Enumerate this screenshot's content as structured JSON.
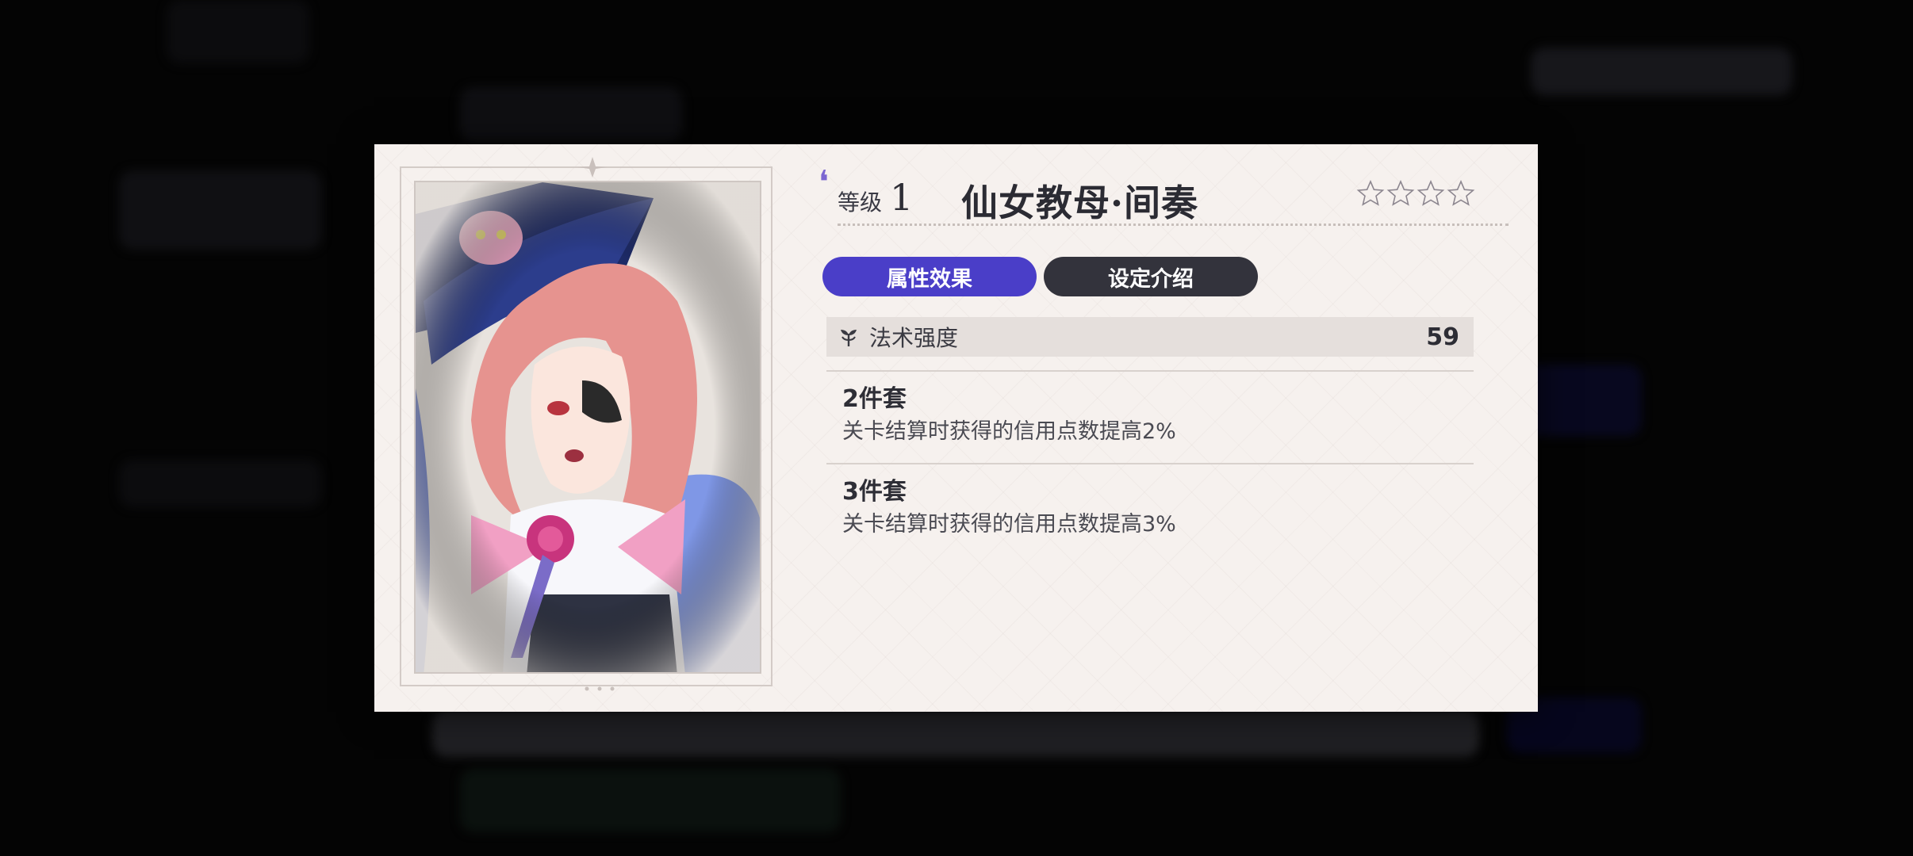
{
  "relic": {
    "level_label": "等级",
    "level_value": "1",
    "name": "仙女教母·间奏",
    "stars_filled": 0,
    "stars_total": 4
  },
  "tabs": [
    {
      "label": "属性效果",
      "active": true
    },
    {
      "label": "设定介绍",
      "active": false
    }
  ],
  "stat": {
    "icon": "sprout-icon",
    "name": "法术强度",
    "value": "59"
  },
  "sets": [
    {
      "title": "2件套",
      "desc": "关卡结算时获得的信用点数提高2%"
    },
    {
      "title": "3件套",
      "desc": "关卡结算时获得的信用点数提高3%"
    }
  ],
  "colors": {
    "accent": "#4a3ec8",
    "tab_inactive": "#33333c",
    "panel_bg": "#f6f1ee"
  }
}
